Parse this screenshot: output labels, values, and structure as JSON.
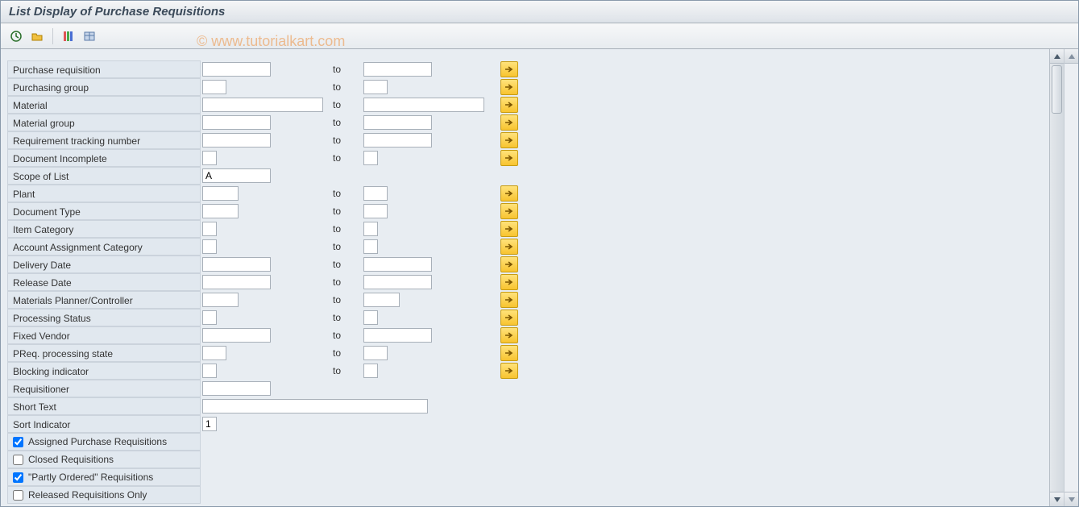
{
  "title": "List Display of Purchase Requisitions",
  "watermark": "© www.tutorialkart.com",
  "toolbar": {
    "t1": "execute-icon",
    "t2": "variant-icon",
    "t3": "selectall-icon",
    "t4": "dynamic-icon"
  },
  "grid": {
    "to_label": "to"
  },
  "fields": {
    "pr": {
      "label": "Purchase requisition",
      "from": "",
      "to": "",
      "fw": "w-85",
      "tw": "w-85",
      "more": true
    },
    "pgrp": {
      "label": "Purchasing group",
      "from": "",
      "to": "",
      "fw": "w-30",
      "tw": "w-30",
      "more": true
    },
    "mat": {
      "label": "Material",
      "from": "",
      "to": "",
      "fw": "w-150",
      "tw": "w-150",
      "more": true
    },
    "matgrp": {
      "label": "Material group",
      "from": "",
      "to": "",
      "fw": "w-85",
      "tw": "w-85",
      "more": true
    },
    "reqtrk": {
      "label": "Requirement tracking number",
      "from": "",
      "to": "",
      "fw": "w-85",
      "tw": "w-85",
      "more": true
    },
    "docinc": {
      "label": "Document Incomplete",
      "from": "",
      "to": "",
      "fw": "w-18",
      "tw": "w-18",
      "more": true
    },
    "scope": {
      "label": "Scope of List",
      "from": "A",
      "to": null,
      "fw": "w-85",
      "tw": null,
      "more": false
    },
    "plant": {
      "label": "Plant",
      "from": "",
      "to": "",
      "fw": "w-45",
      "tw": "w-30",
      "more": true
    },
    "doctype": {
      "label": "Document Type",
      "from": "",
      "to": "",
      "fw": "w-45",
      "tw": "w-30",
      "more": true
    },
    "itemcat": {
      "label": "Item Category",
      "from": "",
      "to": "",
      "fw": "w-18",
      "tw": "w-18",
      "more": true
    },
    "acctassg": {
      "label": "Account Assignment Category",
      "from": "",
      "to": "",
      "fw": "w-18",
      "tw": "w-18",
      "more": true
    },
    "deliv": {
      "label": "Delivery Date",
      "from": "",
      "to": "",
      "fw": "w-85",
      "tw": "w-85",
      "more": true
    },
    "reldate": {
      "label": "Release Date",
      "from": "",
      "to": "",
      "fw": "w-85",
      "tw": "w-85",
      "more": true
    },
    "mrpc": {
      "label": "Materials Planner/Controller",
      "from": "",
      "to": "",
      "fw": "w-45",
      "tw": "w-45",
      "more": true
    },
    "pstat": {
      "label": "Processing Status",
      "from": "",
      "to": "",
      "fw": "w-18",
      "tw": "w-18",
      "more": true
    },
    "fixven": {
      "label": "Fixed Vendor",
      "from": "",
      "to": "",
      "fw": "w-85",
      "tw": "w-85",
      "more": true
    },
    "preqps": {
      "label": "PReq. processing state",
      "from": "",
      "to": "",
      "fw": "w-30",
      "tw": "w-30",
      "more": true
    },
    "blkind": {
      "label": "Blocking indicator",
      "from": "",
      "to": "",
      "fw": "w-18",
      "tw": "w-18",
      "more": true
    },
    "reqnr": {
      "label": "Requisitioner",
      "from": "",
      "to": null,
      "fw": "w-85",
      "tw": null,
      "more": false
    },
    "stxt": {
      "label": "Short Text",
      "from": "",
      "to": null,
      "fw": "w-280",
      "tw": null,
      "more": false
    },
    "sortind": {
      "label": "Sort Indicator",
      "from": "1",
      "to": null,
      "fw": "w-18",
      "tw": null,
      "more": false
    }
  },
  "checks": {
    "c1": {
      "label": "Assigned Purchase Requisitions",
      "checked": true
    },
    "c2": {
      "label": "Closed Requisitions",
      "checked": false
    },
    "c3": {
      "label": "\"Partly Ordered\" Requisitions",
      "checked": true
    },
    "c4": {
      "label": "Released Requisitions Only",
      "checked": false
    }
  }
}
